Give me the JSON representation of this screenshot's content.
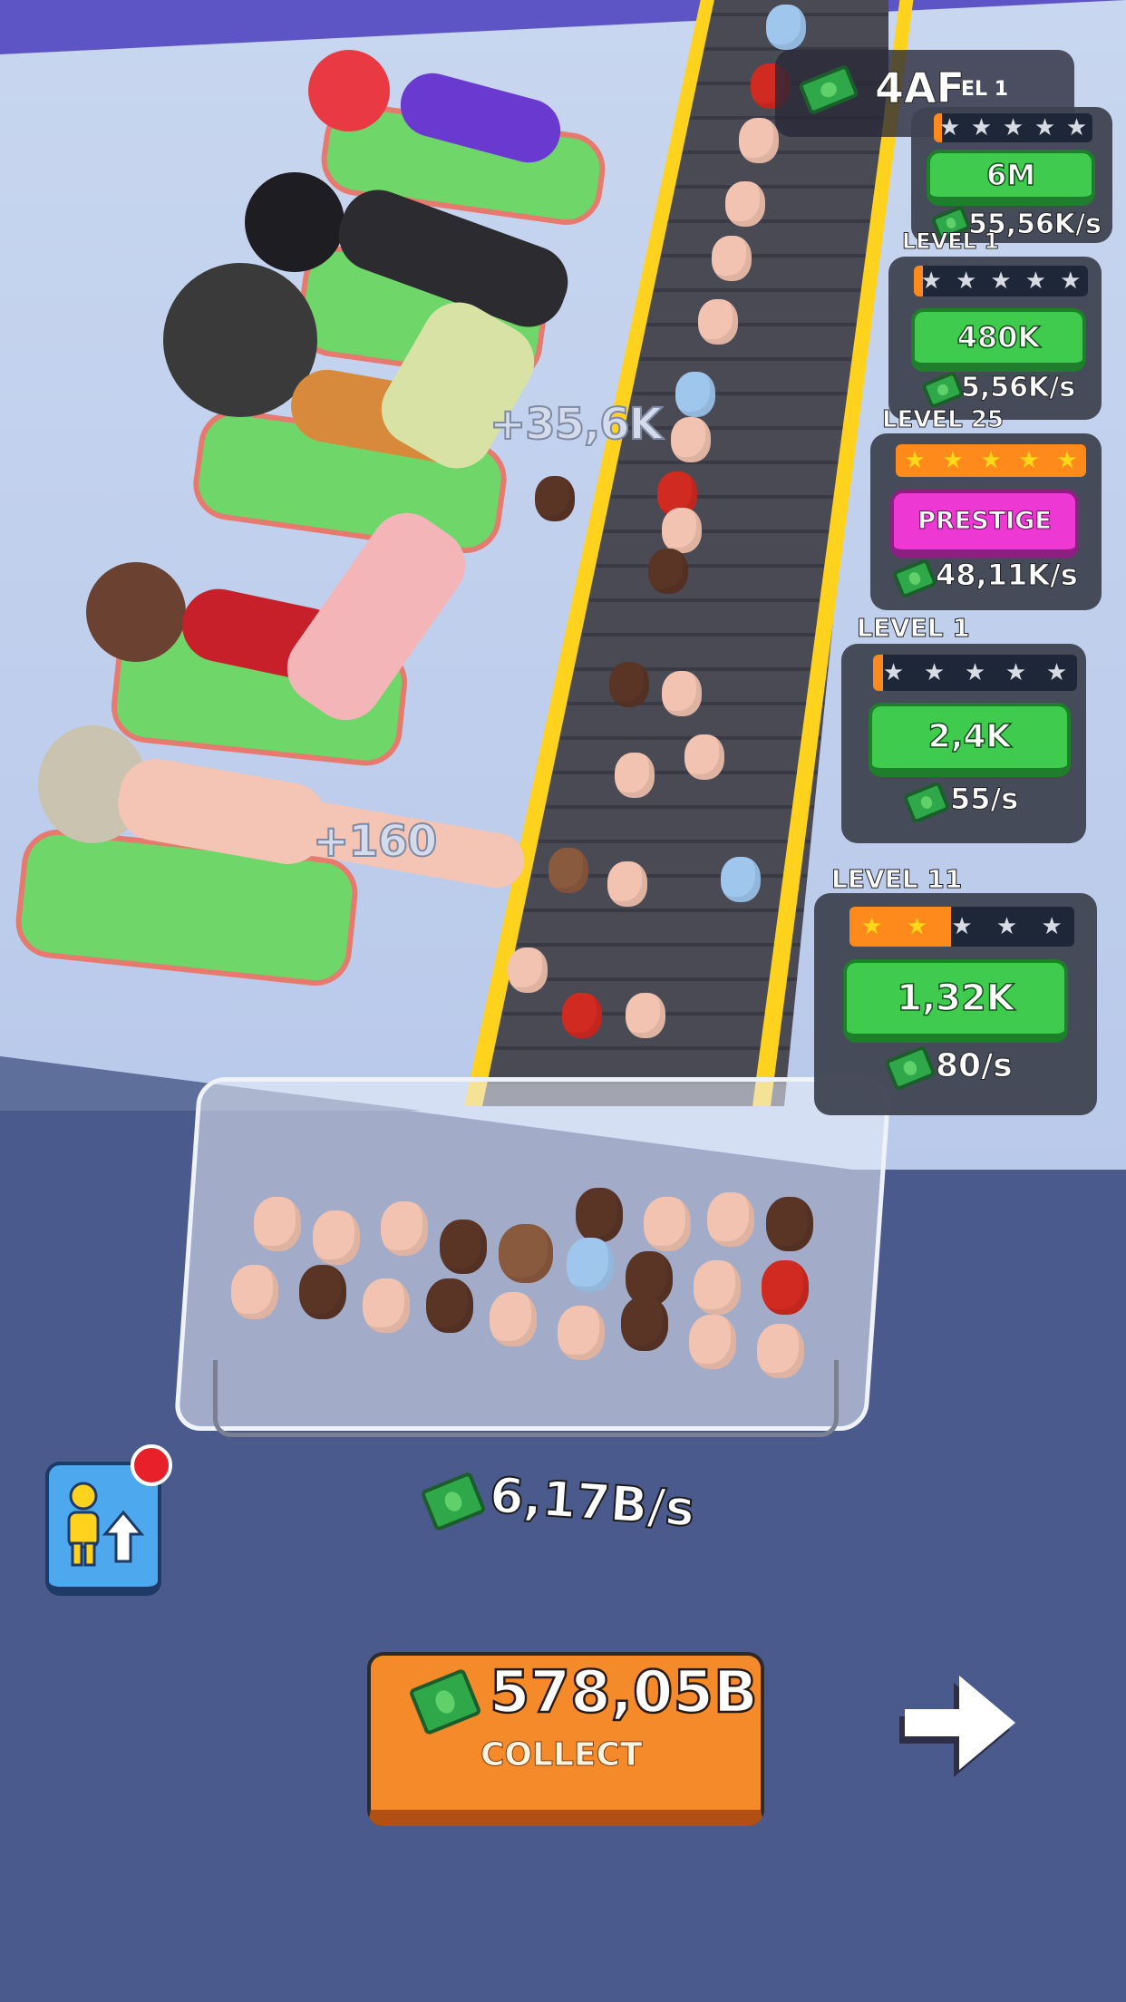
{
  "hud": {
    "currency_value": "4AF",
    "currency_partial_label": "EL 1"
  },
  "stations": [
    {
      "level": "",
      "stars_filled": 0,
      "progress": 0.05,
      "button": "6M",
      "button_type": "upgrade",
      "rate": "55,56K/s"
    },
    {
      "level": "LEVEL 1",
      "stars_filled": 0,
      "progress": 0.05,
      "button": "480K",
      "button_type": "upgrade",
      "rate": "5,56K/s"
    },
    {
      "level": "LEVEL 25",
      "stars_filled": 5,
      "progress": 1.0,
      "button": "PRESTIGE",
      "button_type": "prestige",
      "rate": "48,11K/s"
    },
    {
      "level": "LEVEL 1",
      "stars_filled": 0,
      "progress": 0.05,
      "button": "2,4K",
      "button_type": "upgrade",
      "rate": "55/s"
    },
    {
      "level": "LEVEL 11",
      "stars_filled": 2,
      "progress": 0.45,
      "button": "1,32K",
      "button_type": "upgrade",
      "rate": "80/s"
    }
  ],
  "floating_texts": [
    "+35,6K",
    "+160"
  ],
  "total_rate": "6,17B/s",
  "collect": {
    "amount": "578,05B",
    "label": "COLLECT"
  },
  "colors": {
    "bed": "#6fd66a",
    "conveyor_rail": "#ffd21e",
    "collect": "#f58a2a",
    "upgrade": "#3fcb4e",
    "prestige": "#ee38d4"
  },
  "icons": [
    "cash-icon",
    "hire-worker-icon",
    "next-arrow-icon",
    "notification-dot",
    "star-icon"
  ]
}
